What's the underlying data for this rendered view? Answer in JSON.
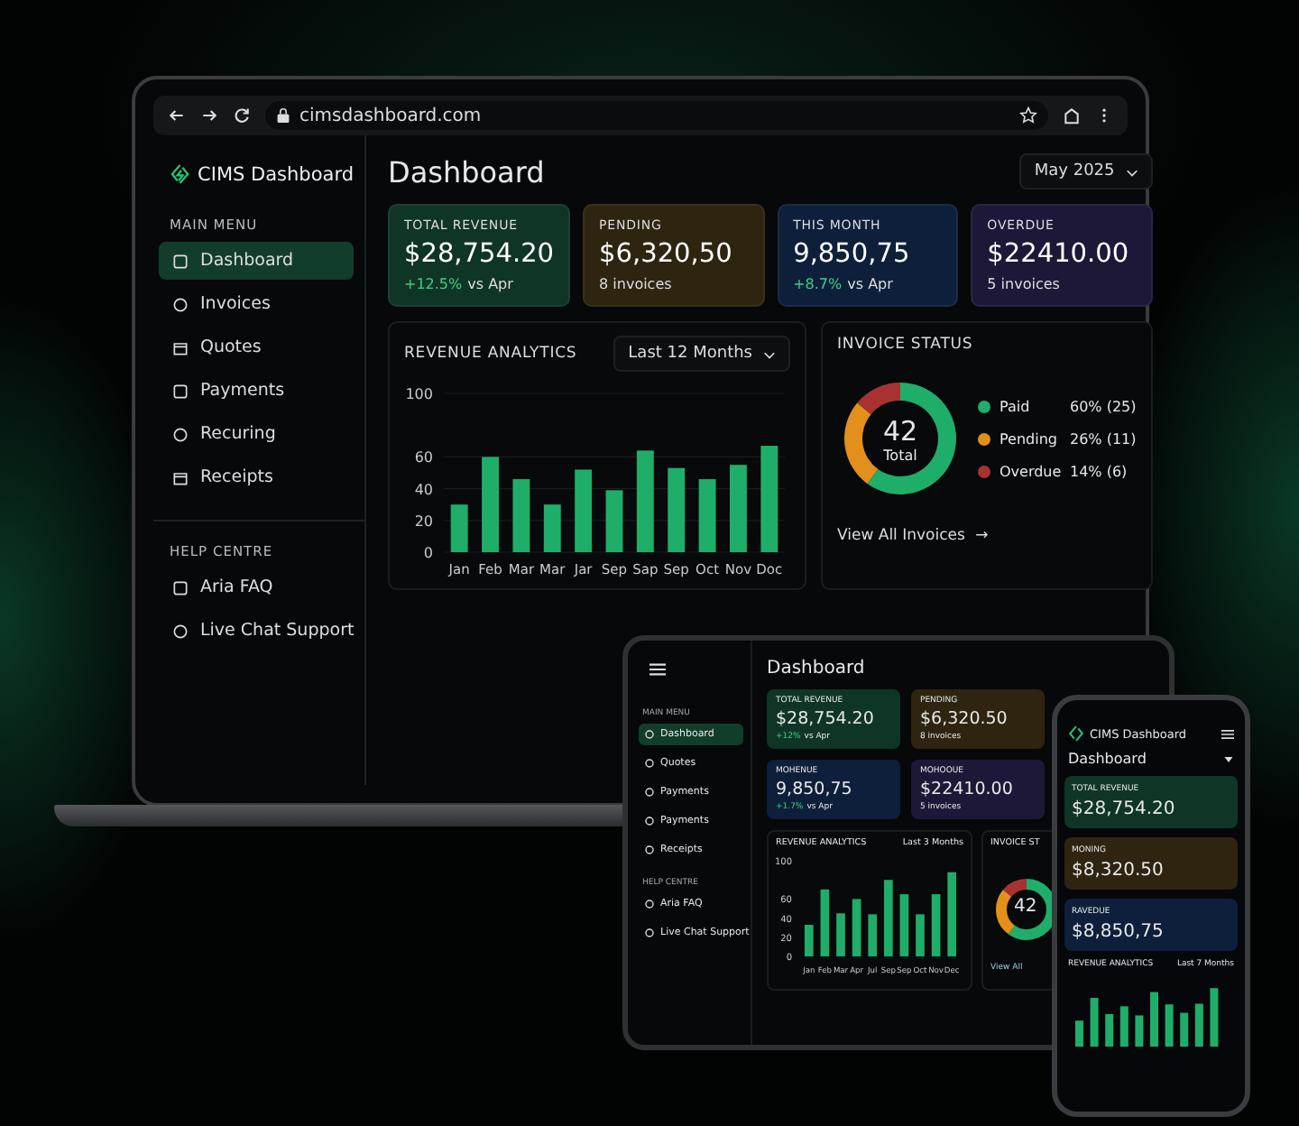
{
  "laptop": {
    "browser": {
      "url": "cimsdashboard.com"
    },
    "brand": "CIMS Dashboard",
    "sidebar": [
      {
        "heading": "MAIN MENU",
        "items": [
          {
            "label": "Dashboard",
            "selected": true
          },
          {
            "label": "Invoices",
            "selected": false
          },
          {
            "label": "Quotes",
            "selected": false
          },
          {
            "label": "Payments",
            "selected": false
          },
          {
            "label": "Recuring",
            "selected": false
          },
          {
            "label": "Receipts",
            "selected": false
          }
        ]
      },
      {
        "heading": "HELP CENTRE",
        "items": [
          {
            "label": "Aria FAQ",
            "selected": false
          },
          {
            "label": "Live Chat Support",
            "selected": false
          }
        ]
      }
    ],
    "title": "Dashboard",
    "period": "May 2025",
    "cards": [
      {
        "label": "TOTAL REVENUE",
        "value": "$28,754.20",
        "change": "+12.5%",
        "note": "vs Apr",
        "color": "#0f3526"
      },
      {
        "label": "PENDING",
        "value": "$6,320,50",
        "note": "8 invoices",
        "color": "#2e2410"
      },
      {
        "label": "THIS MONTH",
        "value": "9,850,75",
        "change": "+8.7%",
        "note": "vs Apr",
        "color": "#0d1f3a"
      },
      {
        "label": "OVERDUE",
        "value": "$22410.00",
        "note": "5 invoices",
        "color": "#1e1838"
      }
    ],
    "revenue": {
      "title": "REVENUE ANALYTICS",
      "range": "Last 12 Months",
      "chart_data": {
        "type": "bar",
        "categories": [
          "Jan",
          "Feb",
          "Mar",
          "Mar",
          "Jar",
          "Sep",
          "Sap",
          "Sep",
          "Oct",
          "Nov",
          "Doc"
        ],
        "series": [
          {
            "color": "#1fae6a",
            "values": [
              30,
              60,
              46,
              30,
              52,
              39,
              64,
              53,
              46,
              55,
              67
            ]
          }
        ],
        "ylim": [
          0,
          100
        ],
        "yticks": [
          0,
          20,
          40,
          60,
          100
        ],
        "grid": true
      }
    },
    "invoice_status": {
      "title": "INVOICE STATUS",
      "total": "42",
      "total_label": "Total",
      "legend": [
        {
          "figure": "60% (25)",
          "color": "#1fae6a"
        },
        {
          "figure": "26% (11)",
          "color": "#e38f1c"
        },
        {
          "figure": "14% (6)",
          "color": "#a83232"
        }
      ],
      "chart_data": {
        "type": "donut",
        "categories": [
          "Paid",
          "Pending",
          "Overdue"
        ],
        "series": [
          {
            "values": [
              60,
              26,
              14
            ]
          }
        ]
      },
      "link": "View All Invoices",
      "link_arrow": "→"
    }
  },
  "tablet": {
    "title": "Dashboard",
    "sidebar": [
      {
        "heading": "MAIN MENU",
        "items": [
          {
            "label": "Dashboard",
            "selected": true
          },
          {
            "label": "Quotes",
            "selected": false
          },
          {
            "label": "Payments",
            "selected": false
          },
          {
            "label": "Payments",
            "selected": false
          },
          {
            "label": "Receipts",
            "selected": false
          }
        ]
      },
      {
        "heading": "HELP CENTRE",
        "items": [
          {
            "label": "Aria FAQ",
            "selected": false
          },
          {
            "label": "Live Chat Support",
            "selected": false
          }
        ]
      }
    ],
    "cards": [
      {
        "label": "TOTAL REVENUE",
        "value": "$28,754.20",
        "change": "+12%",
        "note": "vs Apr",
        "color": "#0f3526"
      },
      {
        "label": "PENDING",
        "value": "$6,320.50",
        "note": "8 invoices",
        "color": "#2e2410"
      },
      {
        "label": "MOHENUE",
        "value": "9,850,75",
        "change": "+1.7%",
        "note": "vs Apr",
        "color": "#0d1f3a"
      },
      {
        "label": "MOHOOUE",
        "value": "$22410.00",
        "note": "5 invoices",
        "color": "#1e1838"
      }
    ],
    "revenue": {
      "title": "REVENUE ANALYTICS",
      "range": "Last 3 Months",
      "chart_data": {
        "type": "bar",
        "categories": [
          "Jan",
          "Feb",
          "Mar",
          "Apr",
          "Jul",
          "Sep",
          "Sep",
          "Oct",
          "Nov",
          "Dec"
        ],
        "series": [
          {
            "color": "#1fae6a",
            "values": [
              33,
              70,
              45,
              60,
              44,
              80,
              65,
              44,
              65,
              88
            ]
          }
        ],
        "ylim": [
          0,
          100
        ],
        "yticks": [
          0,
          20,
          40,
          60,
          100
        ]
      }
    },
    "invoice_status": {
      "title": "INVOICE ST",
      "total": "42",
      "link": "View All"
    }
  },
  "phone": {
    "brand": "CIMS Dashboard",
    "title": "Dashboard",
    "cards": [
      {
        "label": "TOTAL REVENUE",
        "value": "$28,754.20",
        "color": "#0f3526"
      },
      {
        "label": "MONING",
        "value": "$8,320.50",
        "color": "#2e2410"
      },
      {
        "label": "RAVEDUE",
        "value": "$8,850,75",
        "color": "#0d1f3a"
      }
    ],
    "revenue": {
      "title": "REVENUE ANALYTICS",
      "range": "Last 7 Months"
    }
  }
}
